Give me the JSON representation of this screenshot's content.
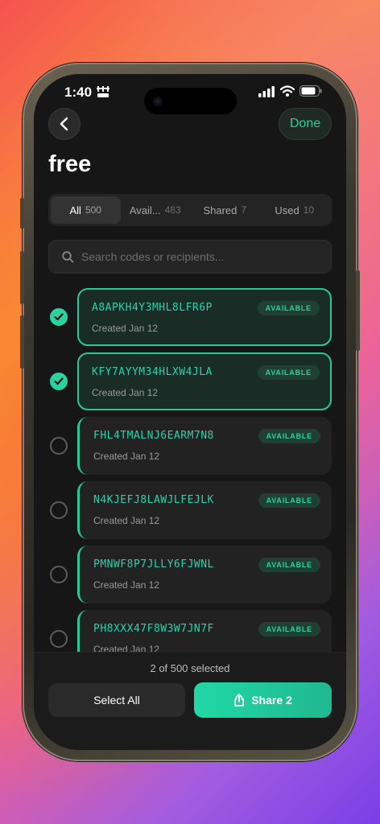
{
  "status_bar": {
    "time": "1:40"
  },
  "header": {
    "back_icon": "chevron-left-icon",
    "done_label": "Done",
    "title": "free"
  },
  "filter_tabs": [
    {
      "label": "All",
      "count": "500",
      "active": true
    },
    {
      "label": "Avail...",
      "count": "483",
      "active": false
    },
    {
      "label": "Shared",
      "count": "7",
      "active": false
    },
    {
      "label": "Used",
      "count": "10",
      "active": false
    }
  ],
  "search": {
    "placeholder": "Search codes or recipients..."
  },
  "codes": [
    {
      "code": "A8APKH4Y3MHL8LFR6P",
      "created": "Created Jan 12",
      "status": "AVAILABLE",
      "selected": true
    },
    {
      "code": "KFY7AYYM34HLXW4JLA",
      "created": "Created Jan 12",
      "status": "AVAILABLE",
      "selected": true
    },
    {
      "code": "FHL4TMALNJ6EARM7N8",
      "created": "Created Jan 12",
      "status": "AVAILABLE",
      "selected": false
    },
    {
      "code": "N4KJEFJ8LAWJLFEJLK",
      "created": "Created Jan 12",
      "status": "AVAILABLE",
      "selected": false
    },
    {
      "code": "PMNWF8P7JLLY6FJWNL",
      "created": "Created Jan 12",
      "status": "AVAILABLE",
      "selected": false
    },
    {
      "code": "PH8XXX47F8W3W7JN7F",
      "created": "Created Jan 12",
      "status": "AVAILABLE",
      "selected": false
    }
  ],
  "footer": {
    "selection_text": "2 of 500 selected",
    "select_all_label": "Select All",
    "share_label": "Share 2"
  },
  "colors": {
    "accent": "#29d3a0",
    "screen_bg": "#161616",
    "card_bg": "#222222"
  }
}
